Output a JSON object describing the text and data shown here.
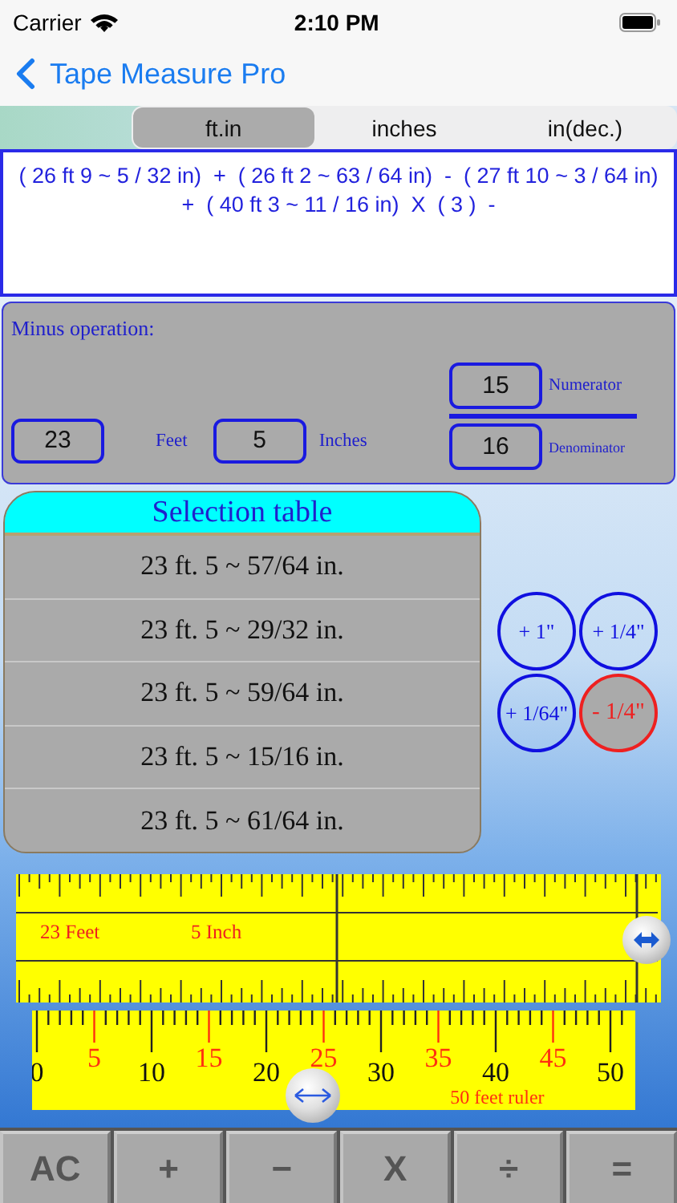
{
  "status_bar": {
    "carrier": "Carrier",
    "time": "2:10 PM"
  },
  "nav": {
    "back_label": "Tape Measure Pro"
  },
  "tabs": [
    {
      "label": "ft.in",
      "selected": true
    },
    {
      "label": "inches",
      "selected": false
    },
    {
      "label": "in(dec.)",
      "selected": false
    }
  ],
  "expression": "( 26 ft 9 ~ 5 / 32 in)  +  ( 26 ft 2 ~ 63 / 64 in)  -  ( 27 ft 10 ~ 3 / 64 in)  +  ( 40 ft 3 ~ 11 / 16 in)  X  ( 3 )  -",
  "operation": {
    "title": "Minus operation:",
    "feet": "23",
    "feet_label": "Feet",
    "inches": "5",
    "inches_label": "Inches",
    "numerator": "15",
    "numerator_label": "Numerator",
    "denominator": "16",
    "denominator_label": "Denominator"
  },
  "selection_table": {
    "title": "Selection table",
    "rows": [
      "23 ft. 5 ~ 57/64 in.",
      "23 ft. 5 ~ 29/32 in.",
      "23 ft. 5 ~ 59/64 in.",
      "23 ft. 5 ~ 15/16 in.",
      "23 ft. 5 ~ 61/64 in."
    ]
  },
  "step_buttons": [
    {
      "label": "+ 1\"",
      "kind": "add",
      "color": "#1010e0"
    },
    {
      "label": "+ 1/4\"",
      "kind": "add",
      "color": "#1010e0"
    },
    {
      "label": "+ 1/64\"",
      "kind": "add",
      "color": "#1010e0"
    },
    {
      "label": "- 1/4\"",
      "kind": "subtract",
      "color": "#ee2020"
    }
  ],
  "fine_ruler": {
    "feet_reading": "23 Feet",
    "inch_reading": "5 Inch"
  },
  "feet_ruler": {
    "labels": [
      "0",
      "5",
      "10",
      "15",
      "20",
      "25",
      "30",
      "35",
      "40",
      "45",
      "50"
    ],
    "caption": "50 feet ruler"
  },
  "keypad": [
    "AC",
    "+",
    "−",
    "X",
    "÷",
    "="
  ]
}
